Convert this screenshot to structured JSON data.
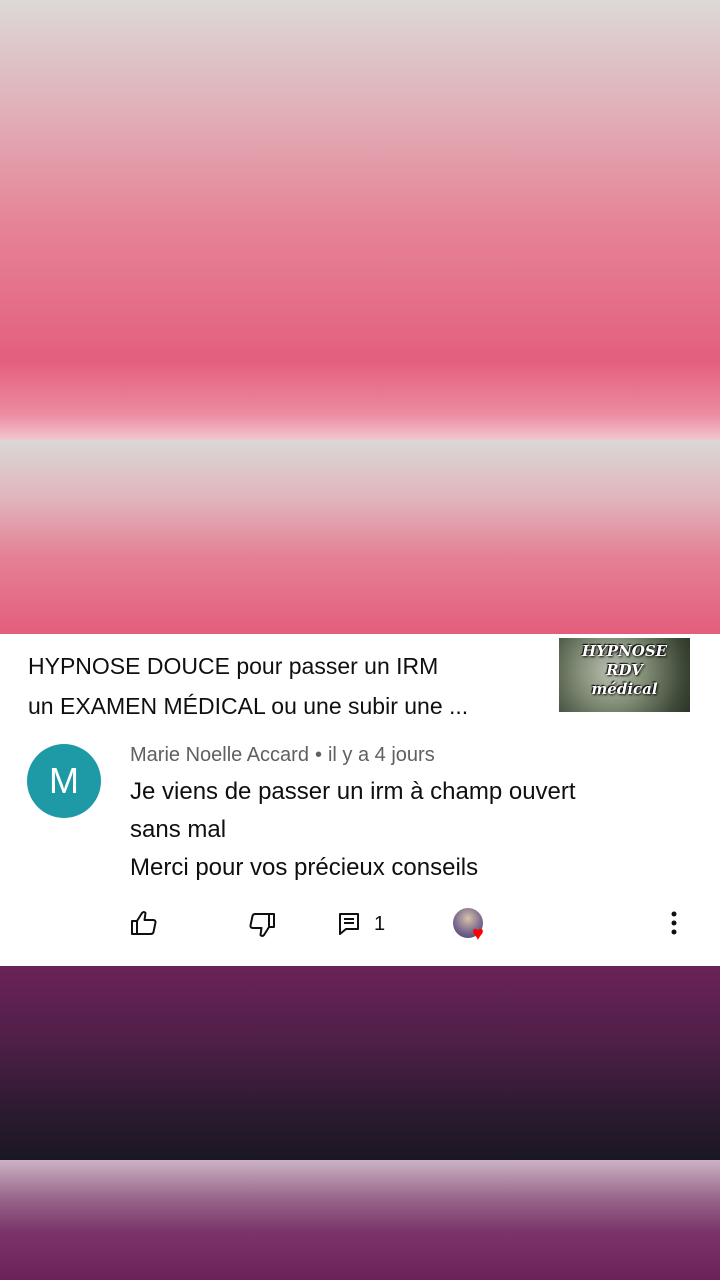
{
  "video": {
    "title_line1": "HYPNOSE DOUCE pour passer un IRM",
    "title_line2": "un EXAMEN MÉDICAL ou une subir une ...",
    "thumbnail_text": [
      "HYPNOSE",
      "RDV",
      "médical"
    ]
  },
  "comment": {
    "avatar_letter": "M",
    "author": "Marie Noelle Accard",
    "separator": "•",
    "time": "il y a 4 jours",
    "lines": [
      "Je viens de passer un irm à champ ouvert",
      "sans mal",
      "Merci pour vos précieux conseils"
    ],
    "reply_count": "1"
  },
  "icons": {
    "like": "thumb-up-icon",
    "dislike": "thumb-down-icon",
    "reply": "comment-icon",
    "creator_heart": "heart-icon",
    "more": "more-vertical-icon"
  },
  "colors": {
    "avatar_bg": "#1e9aa7",
    "heart": "#ff0000",
    "text_primary": "#0f0f0f",
    "text_secondary": "#606060"
  }
}
